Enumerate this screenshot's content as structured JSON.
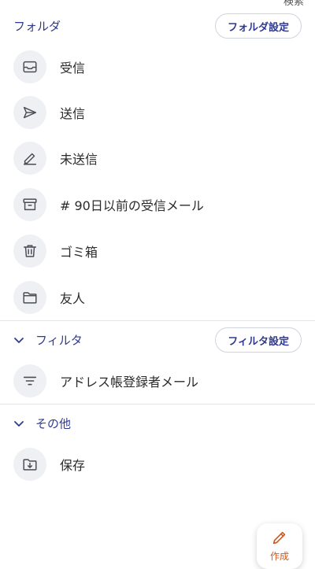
{
  "top_cut_text": "検索",
  "folders": {
    "title": "フォルダ",
    "settings_label": "フォルダ設定",
    "items": [
      {
        "label": "受信",
        "icon": "inbox-icon"
      },
      {
        "label": "送信",
        "icon": "send-icon"
      },
      {
        "label": "未送信",
        "icon": "pencil-icon"
      },
      {
        "label": "# 90日以前の受信メール",
        "icon": "archive-box-icon"
      },
      {
        "label": "ゴミ箱",
        "icon": "trash-icon"
      },
      {
        "label": "友人",
        "icon": "folder-icon"
      }
    ]
  },
  "filters": {
    "title": "フィルタ",
    "settings_label": "フィルタ設定",
    "items": [
      {
        "label": "アドレス帳登録者メール",
        "icon": "filter-lines-icon"
      }
    ]
  },
  "others": {
    "title": "その他",
    "items": [
      {
        "label": "保存",
        "icon": "folder-download-icon"
      }
    ]
  },
  "fab": {
    "label": "作成",
    "icon": "pencil-icon"
  },
  "colors": {
    "accent": "#2f3a8f",
    "fab_accent": "#d0591c",
    "icon_bg": "#eef0f3"
  }
}
